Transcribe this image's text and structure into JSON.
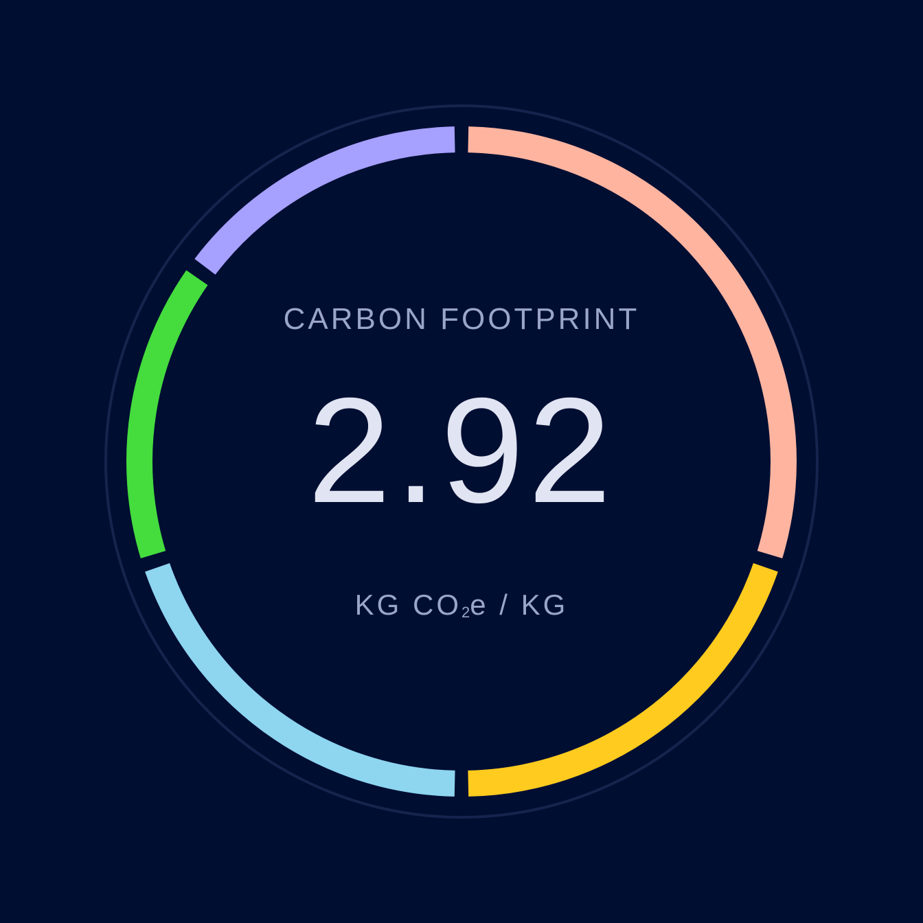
{
  "metric": {
    "label": "CARBON FOOTPRINT",
    "value": "2.92",
    "unit_prefix": "KG CO",
    "unit_sub": "2",
    "unit_suffix": "e / KG"
  },
  "chart_data": {
    "type": "pie",
    "style": "donut-ring",
    "title": "",
    "slices": [
      {
        "share_pct": 30,
        "color": "#ffb4a0"
      },
      {
        "share_pct": 20,
        "color": "#ffcb1f"
      },
      {
        "share_pct": 20,
        "color": "#8ed5f0"
      },
      {
        "share_pct": 15,
        "color": "#45dc3e"
      },
      {
        "share_pct": 15,
        "color": "#a6a0ff"
      }
    ]
  },
  "colors": {
    "background": "#000e32",
    "outer_ring": "#15244c",
    "label": "#9aa6c8",
    "value": "#e1e4f2"
  }
}
